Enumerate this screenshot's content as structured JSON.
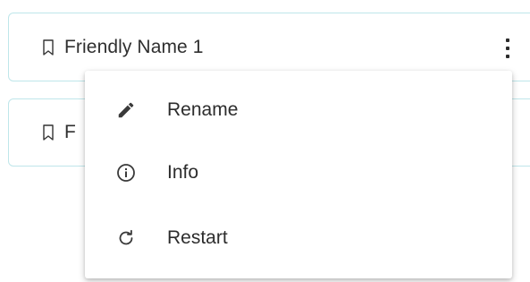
{
  "items": [
    {
      "label": "Friendly Name 1"
    },
    {
      "label": "F"
    }
  ],
  "menu": {
    "items": [
      {
        "label": "Rename",
        "icon": "pencil-icon"
      },
      {
        "label": "Info",
        "icon": "info-icon"
      },
      {
        "label": "Restart",
        "icon": "restart-icon"
      }
    ]
  },
  "colors": {
    "card_border": "#bfe6ea",
    "text": "#2c2c2c"
  }
}
